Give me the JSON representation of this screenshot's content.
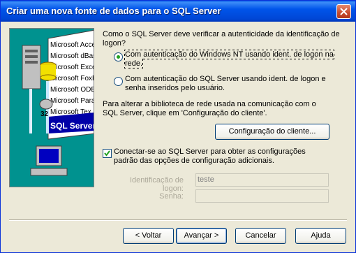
{
  "window": {
    "title": "Criar uma nova fonte de dados para o SQL Server"
  },
  "art": {
    "labels": [
      "Microsoft Access D",
      "Microsoft dBase D",
      "Microsoft Excel D",
      "Microsoft FoxPro",
      "Microsoft ODBC",
      "Microsoft Parad",
      "Microsoft Tex"
    ],
    "banner": "SQL Server",
    "badge": "32"
  },
  "question": "Como o SQL Server deve verificar a autenticidade da identificação de logon?",
  "auth_options": [
    {
      "label": "Com autenticação do Windows NT usando ident. de logon na rede.",
      "selected": true
    },
    {
      "label": "Com autenticação do SQL Server usando ident. de logon e senha inseridos pelo usuário.",
      "selected": false
    }
  ],
  "network_info": "Para alterar a biblioteca de rede usada na comunicação com o SQL Server, clique em 'Configuração do cliente'.",
  "client_config_button": "Configuração do cliente...",
  "connect_checkbox": {
    "label": "Conectar-se ao SQL Server para obter as configurações padrão das opções de configuração adicionais.",
    "checked": true
  },
  "login_id": {
    "label": "Identificação de logon:",
    "value": "teste"
  },
  "password": {
    "label": "Senha:",
    "value": ""
  },
  "buttons": {
    "back": "< Voltar",
    "next": "Avançar >",
    "cancel": "Cancelar",
    "help": "Ajuda"
  },
  "colors": {
    "title_bar": "#0055ea",
    "art_bg": "#00928f",
    "radio_dot": "#21a121"
  }
}
